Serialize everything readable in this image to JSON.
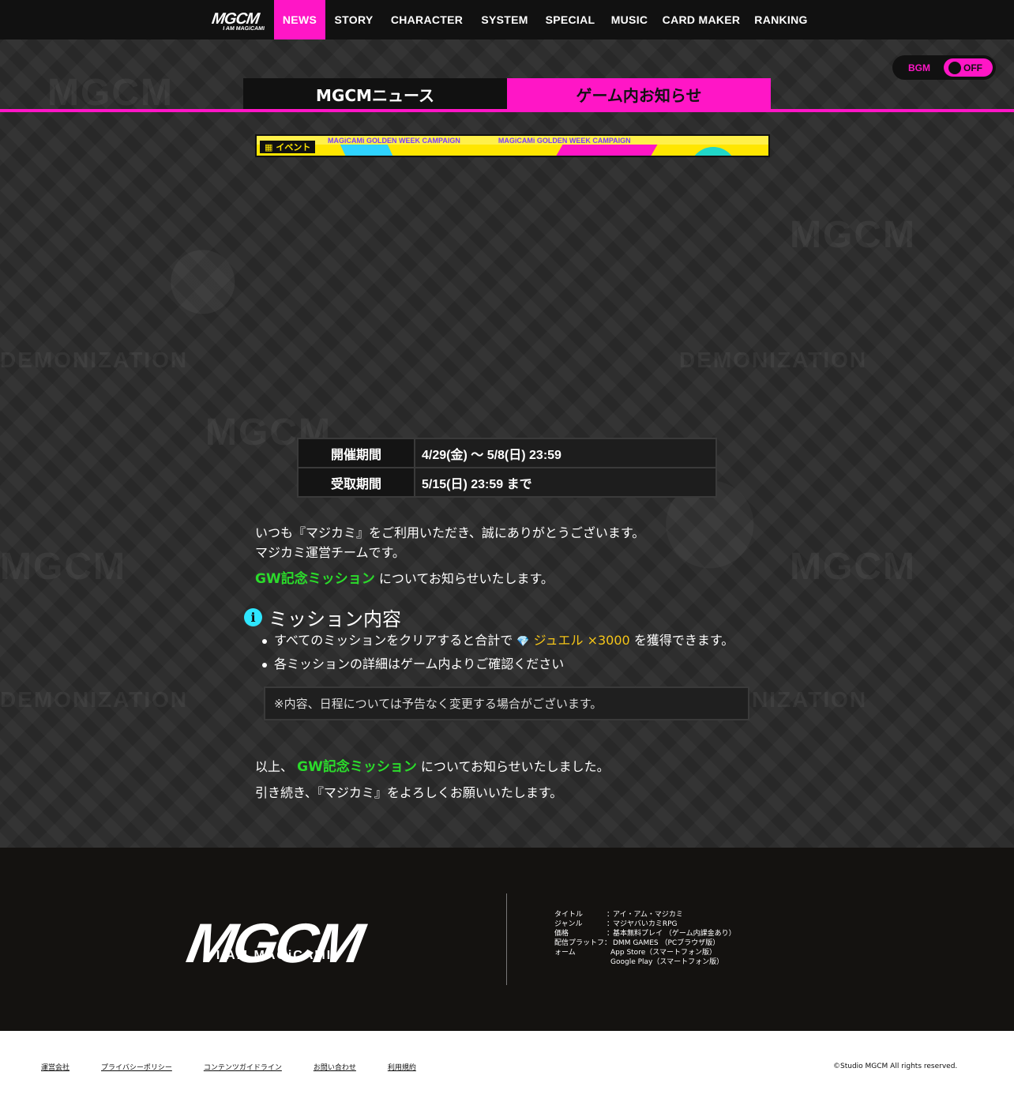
{
  "header": {
    "logo_text": "MGCM",
    "logo_sub": "I AM MAGiCAMI",
    "nav": [
      {
        "label": "NEWS",
        "active": true
      },
      {
        "label": "STORY",
        "active": false
      },
      {
        "label": "CHARACTER",
        "active": false
      },
      {
        "label": "SYSTEM",
        "active": false
      },
      {
        "label": "SPECIAL",
        "active": false
      },
      {
        "label": "MUSIC",
        "active": false
      },
      {
        "label": "CARD MAKER",
        "active": false
      },
      {
        "label": "RANKING",
        "active": false
      }
    ]
  },
  "bgm": {
    "label": "BGM",
    "state": "OFF"
  },
  "tabs": {
    "news": "MGCMニュース",
    "ingame": "ゲーム内お知らせ"
  },
  "banner": {
    "tag": "イベント",
    "marquee": [
      "MAGiCAMi GOLDEN WEEK CAMPAIGN",
      "MAGiCAMi GOLDEN WEEK CAMPAIGN"
    ]
  },
  "period": {
    "rows": [
      {
        "label": "開催期間",
        "value": "4/29(金) ～ 5/8(日) 23:59"
      },
      {
        "label": "受取期間",
        "value": "5/15(日) 23:59 まで"
      }
    ]
  },
  "intro": {
    "line1": "いつも『マジカミ』をご利用いただき、誠にありがとうございます。",
    "line2": "マジカミ運営チームです。",
    "highlight": "GW記念ミッション",
    "line3_rest": "についてお知らせいたします。"
  },
  "section": {
    "icon": "info-icon",
    "title": "ミッション内容",
    "items": [
      {
        "before": "すべてのミッションをクリアすると合計で",
        "gem_icon": "💎",
        "reward": "ジュエル ×3000",
        "after": "を獲得できます。"
      },
      {
        "text": "各ミッションの詳細はゲーム内よりご確認ください"
      }
    ],
    "note": "※内容、日程については予告なく変更する場合がございます。"
  },
  "outro": {
    "prefix": "以上、",
    "highlight": "GW記念ミッション",
    "suffix": "についてお知らせいたしました。",
    "line2": "引き続き、『マジカミ』をよろしくお願いいたします。"
  },
  "footer": {
    "logo_big": "MGCM",
    "logo_sub": "I AM MAGiCAMI",
    "specs": [
      {
        "key": "タイトル",
        "value": "アイ・アム・マジカミ"
      },
      {
        "key": "ジャンル",
        "value": "マジヤバいカミRPG"
      },
      {
        "key": "価格",
        "value": "基本無料プレイ （ゲーム内課金あり）"
      },
      {
        "key": "配信プラットフ：",
        "value": "DMM GAMES （PCブラウザ版）"
      },
      {
        "key": "ォーム",
        "value": "App Store（スマートフォン版）"
      },
      {
        "key": "",
        "value": "Google Play（スマートフォン版）"
      }
    ],
    "links": [
      "運営会社",
      "プライバシーポリシー",
      "コンテンツガイドライン",
      "お問い合わせ",
      "利用規約"
    ],
    "copyright": "©Studio MGCM All rights reserved."
  },
  "colors": {
    "accent": "#ff16c6",
    "highlight": "#2bdc2b",
    "reward": "#f5c518",
    "info": "#2ee6ff"
  }
}
